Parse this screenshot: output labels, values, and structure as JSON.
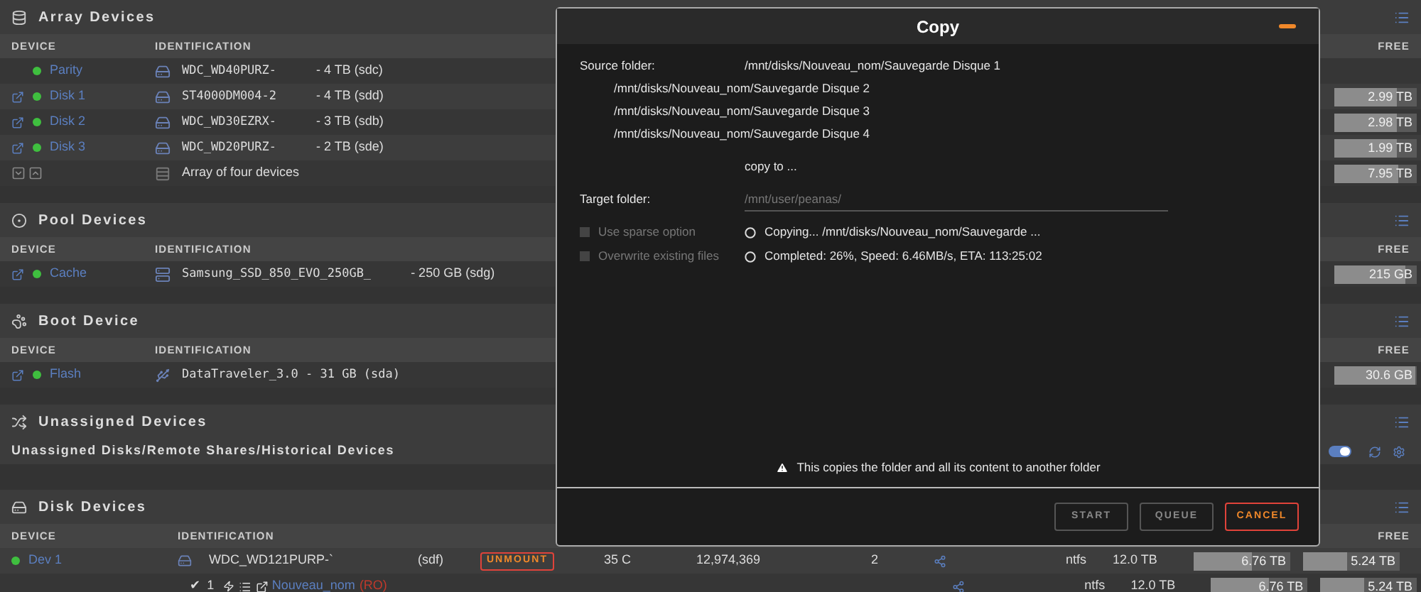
{
  "array_devices": {
    "title": "Array Devices",
    "columns": [
      "DEVICE",
      "IDENTIFICATION",
      "FREE"
    ],
    "rows": [
      {
        "name": "Parity",
        "link_icon": false,
        "kind": "hdd",
        "identification": "WDC_WD40PURZ-",
        "size": "- 4 TB (sdc)"
      },
      {
        "name": "Disk 1",
        "link_icon": true,
        "kind": "hdd",
        "identification": "ST4000DM004-2",
        "size": "- 4 TB (sdd)",
        "free": "2.99 TB",
        "level": 0.75
      },
      {
        "name": "Disk 2",
        "link_icon": true,
        "kind": "hdd",
        "identification": "WDC_WD30EZRX-",
        "size": "- 3 TB (sdb)",
        "free": "2.98 TB",
        "level": 0.75
      },
      {
        "name": "Disk 3",
        "link_icon": true,
        "kind": "hdd",
        "identification": "WDC_WD20PURZ-",
        "size": "- 2 TB (sde)",
        "free": "1.99 TB",
        "level": 0.75
      }
    ],
    "summary": {
      "text": "Array of four devices",
      "free": "7.95 TB",
      "level": 0.77
    }
  },
  "pool_devices": {
    "title": "Pool Devices",
    "columns": [
      "DEVICE",
      "IDENTIFICATION",
      "FREE"
    ],
    "rows": [
      {
        "name": "Cache",
        "link_icon": true,
        "kind": "ssd",
        "identification": "Samsung_SSD_850_EVO_250GB_",
        "size": "- 250 GB (sdg)",
        "free": "215 GB",
        "level": 0.86
      }
    ]
  },
  "boot_device": {
    "title": "Boot Device",
    "columns": [
      "DEVICE",
      "IDENTIFICATION",
      "FREE"
    ],
    "rows": [
      {
        "name": "Flash",
        "link_icon": true,
        "kind": "usb",
        "identification": "DataTraveler_3.0 - 31 GB (sda)",
        "free": "30.6 GB",
        "level": 0.98
      }
    ]
  },
  "unassigned_devices": {
    "title": "Unassigned Devices",
    "subtitle": "Unassigned Disks/Remote Shares/Historical Devices",
    "toggle_on": true
  },
  "disk_devices": {
    "title": "Disk Devices",
    "columns": [
      "DEVICE",
      "IDENTIFICATION",
      "FREE"
    ],
    "disk": {
      "name": "Dev 1",
      "identification": "WDC_WD121PURP-`",
      "device": "(sdf)",
      "button": "UNMOUNT",
      "temperature": "35 C",
      "reads": "12,974,369",
      "count": "2",
      "fs": "ntfs",
      "size": "12.0 TB",
      "used": {
        "text": "6.76 TB",
        "level": 0.6
      },
      "free": {
        "text": "5.24 TB",
        "level": 0.45
      }
    },
    "partition": {
      "check": "✔",
      "number": "1",
      "name": "Nouveau_nom",
      "flag": "(RO)",
      "fs": "ntfs",
      "size": "12.0 TB",
      "used": {
        "text": "6.76 TB",
        "level": 0.6
      },
      "free": {
        "text": "5.24 TB",
        "level": 0.45
      }
    }
  },
  "copy_dialog": {
    "title": "Copy",
    "source_label": "Source folder:",
    "sources": [
      "/mnt/disks/Nouveau_nom/Sauvegarde Disque 1",
      "/mnt/disks/Nouveau_nom/Sauvegarde Disque 2",
      "/mnt/disks/Nouveau_nom/Sauvegarde Disque 3",
      "/mnt/disks/Nouveau_nom/Sauvegarde Disque 4"
    ],
    "copy_to": "copy to ...",
    "target_label": "Target folder:",
    "target_placeholder": "/mnt/user/peanas/",
    "options": [
      {
        "label": "Use sparse option",
        "checked": false,
        "disabled": true
      },
      {
        "label": "Overwrite existing files",
        "checked": false,
        "disabled": true
      }
    ],
    "status": [
      "Copying... /mnt/disks/Nouveau_nom/Sauvegarde ...",
      "Completed: 26%,  Speed: 6.46MB/s,  ETA: 113:25:02"
    ],
    "note": "This copies the folder and all its content to another folder",
    "buttons": [
      {
        "label": "START",
        "kind": "default",
        "disabled": true
      },
      {
        "label": "QUEUE",
        "kind": "default",
        "disabled": true
      },
      {
        "label": "CANCEL",
        "kind": "cancel",
        "disabled": false
      }
    ]
  }
}
